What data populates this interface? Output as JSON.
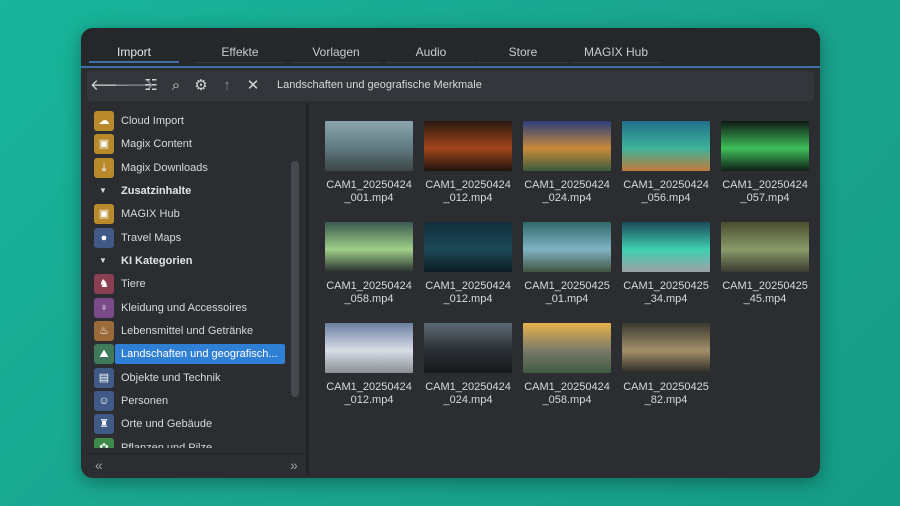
{
  "tabs": [
    {
      "label": "Import"
    },
    {
      "label": "Effekte"
    },
    {
      "label": "Vorlagen"
    },
    {
      "label": "Audio"
    },
    {
      "label": "Store"
    },
    {
      "label": "MAGIX Hub"
    }
  ],
  "toolbar": {
    "back": "🡐",
    "forward": "🡒",
    "tree": "☷",
    "search": "⌕",
    "settings": "⚙",
    "up": "↑",
    "close": "✕",
    "path": "Landschaften und geografische Merkmale"
  },
  "sidebar": {
    "items": [
      {
        "label": "Cloud Import",
        "icon": "☁"
      },
      {
        "label": "Magix Content",
        "icon": "▣"
      },
      {
        "label": "Magix Downloads",
        "icon": "⤓"
      },
      {
        "label": "Zusatzinhalte"
      },
      {
        "label": "MAGIX Hub",
        "icon": "▣"
      },
      {
        "label": "Travel Maps",
        "icon": "●"
      },
      {
        "label": "KI Kategorien"
      },
      {
        "label": "Tiere",
        "icon": "♞"
      },
      {
        "label": "Kleidung und Accessoires",
        "icon": "♀"
      },
      {
        "label": "Lebensmittel und Getränke",
        "icon": "♨"
      },
      {
        "label": "Landschaften und geografisch...",
        "icon": "⛰"
      },
      {
        "label": "Objekte und Technik",
        "icon": "▤"
      },
      {
        "label": "Personen",
        "icon": "☺"
      },
      {
        "label": "Orte und Gebäude",
        "icon": "♜"
      },
      {
        "label": "Pflanzen und Pilze",
        "icon": "✿"
      }
    ],
    "caret": "▼",
    "footer_left": "«",
    "footer_right": "»"
  },
  "files": [
    {
      "name": "CAM1_20250424_001.mp4",
      "colors": [
        "#8aa6ad",
        "#5f7a7f",
        "#3d4546"
      ]
    },
    {
      "name": "CAM1_20250424_012.mp4",
      "colors": [
        "#2a1a12",
        "#a2461a",
        "#1c120d"
      ]
    },
    {
      "name": "CAM1_20250424_024.mp4",
      "colors": [
        "#2b3e7a",
        "#c98a3a",
        "#3b5a3b"
      ]
    },
    {
      "name": "CAM1_20250424_056.mp4",
      "colors": [
        "#1f6f8a",
        "#3fb49a",
        "#c07a3a"
      ]
    },
    {
      "name": "CAM1_20250424_057.mp4",
      "colors": [
        "#0d1a14",
        "#3fbf5a",
        "#0f1e18"
      ]
    },
    {
      "name": "CAM1_20250424_058.mp4",
      "colors": [
        "#3a5a4f",
        "#9fcf8a",
        "#2a2f2f"
      ]
    },
    {
      "name": "CAM1_20250424_012.mp4",
      "colors": [
        "#0f2d3a",
        "#1d4a58",
        "#0c1c22"
      ]
    },
    {
      "name": "CAM1_20250425_01.mp4",
      "colors": [
        "#2f6a6a",
        "#7fb3c4",
        "#40543f"
      ]
    },
    {
      "name": "CAM1_20250425_34.mp4",
      "colors": [
        "#1a4a5a",
        "#3fcfb0",
        "#9fa0a8"
      ]
    },
    {
      "name": "CAM1_20250425_45.mp4",
      "colors": [
        "#4b4f2f",
        "#8a9a6a",
        "#3a3b30"
      ]
    },
    {
      "name": "CAM1_20250424_012.mp4",
      "colors": [
        "#6a7fa0",
        "#d8dde6",
        "#8a8f95"
      ]
    },
    {
      "name": "CAM1_20250424_024.mp4",
      "colors": [
        "#5a6a73",
        "#2a2f33",
        "#15191c"
      ]
    },
    {
      "name": "CAM1_20250424_058.mp4",
      "colors": [
        "#e7b24a",
        "#7a7a6a",
        "#3f5a3f"
      ]
    },
    {
      "name": "CAM1_20250425_82.mp4",
      "colors": [
        "#3a3a30",
        "#a4906a",
        "#2a2b26"
      ]
    }
  ]
}
